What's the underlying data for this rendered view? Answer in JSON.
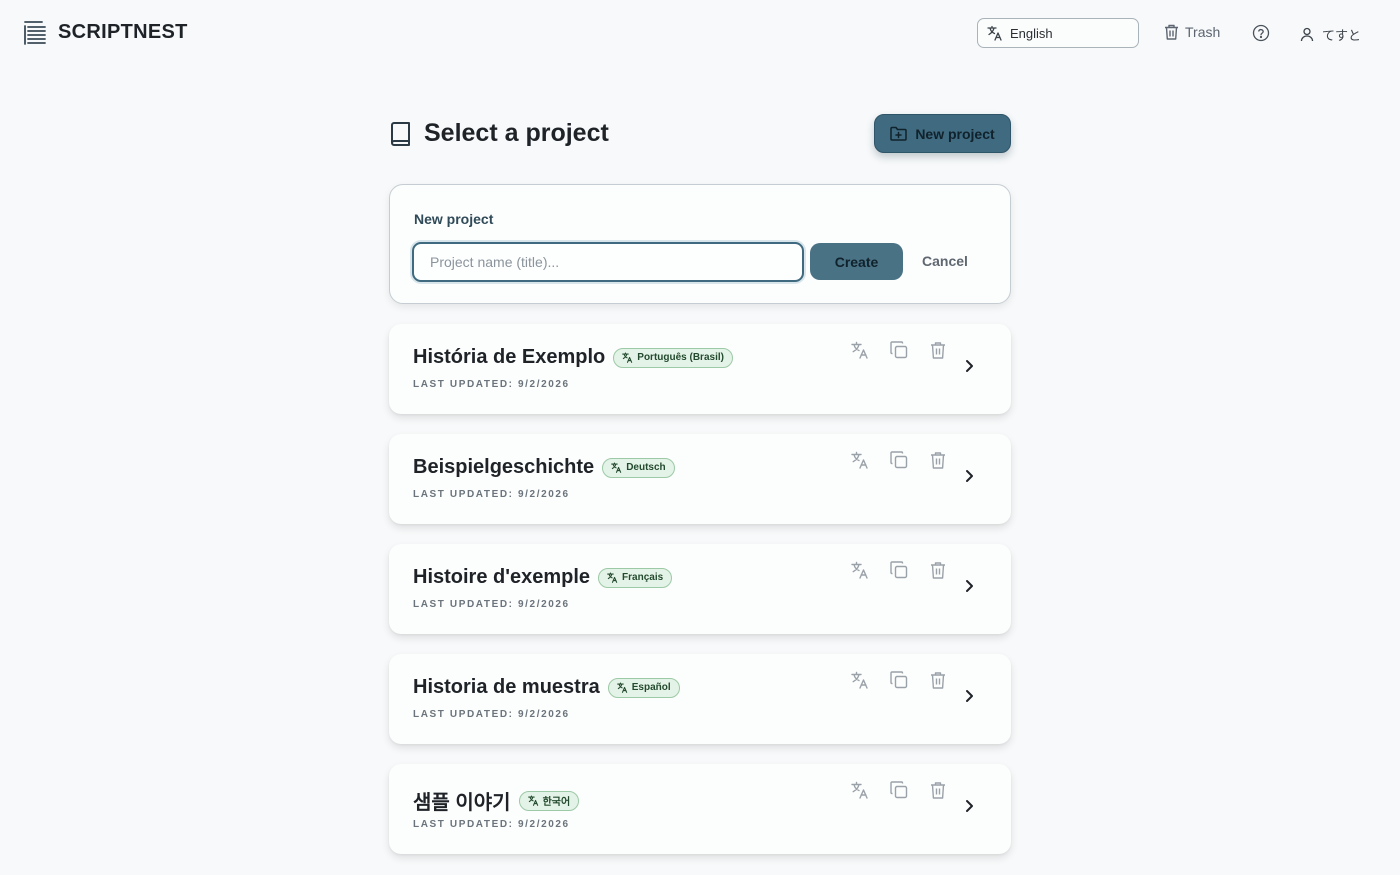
{
  "app": {
    "name": "SCRIPTNEST",
    "language": "English",
    "trash_label": "Trash",
    "user_name": "てすと"
  },
  "page": {
    "title": "Select a project",
    "new_project_label": "New project"
  },
  "new_project_form": {
    "label": "New project",
    "placeholder": "Project name (title)...",
    "value": "",
    "create_label": "Create",
    "cancel_label": "Cancel"
  },
  "projects": [
    {
      "title": "História de Exemplo",
      "language": "Português (Brasil)",
      "updated": "LAST UPDATED: 9/2/2026"
    },
    {
      "title": "Beispielgeschichte",
      "language": "Deutsch",
      "updated": "LAST UPDATED: 9/2/2026"
    },
    {
      "title": "Histoire d'exemple",
      "language": "Français",
      "updated": "LAST UPDATED: 9/2/2026"
    },
    {
      "title": "Historia de muestra",
      "language": "Español",
      "updated": "LAST UPDATED: 9/2/2026"
    },
    {
      "title": "샘플 이야기",
      "language": "한국어",
      "updated": "LAST UPDATED: 9/2/2026"
    }
  ],
  "colors": {
    "primary": "#3f6a7f",
    "badge_bg": "#e4f3e7",
    "badge_border": "#9cc9a6",
    "page_bg": "#f7f9fa"
  },
  "icons": {
    "brand": "list-lines-icon",
    "language": "translate-icon",
    "trash": "trash-icon",
    "help": "question-circle-icon",
    "user": "user-icon",
    "page": "book-icon",
    "new_project": "folder-plus-icon",
    "card_actions": [
      "translate-icon",
      "copy-icon",
      "trash-icon"
    ],
    "open": "chevron-right-icon"
  }
}
